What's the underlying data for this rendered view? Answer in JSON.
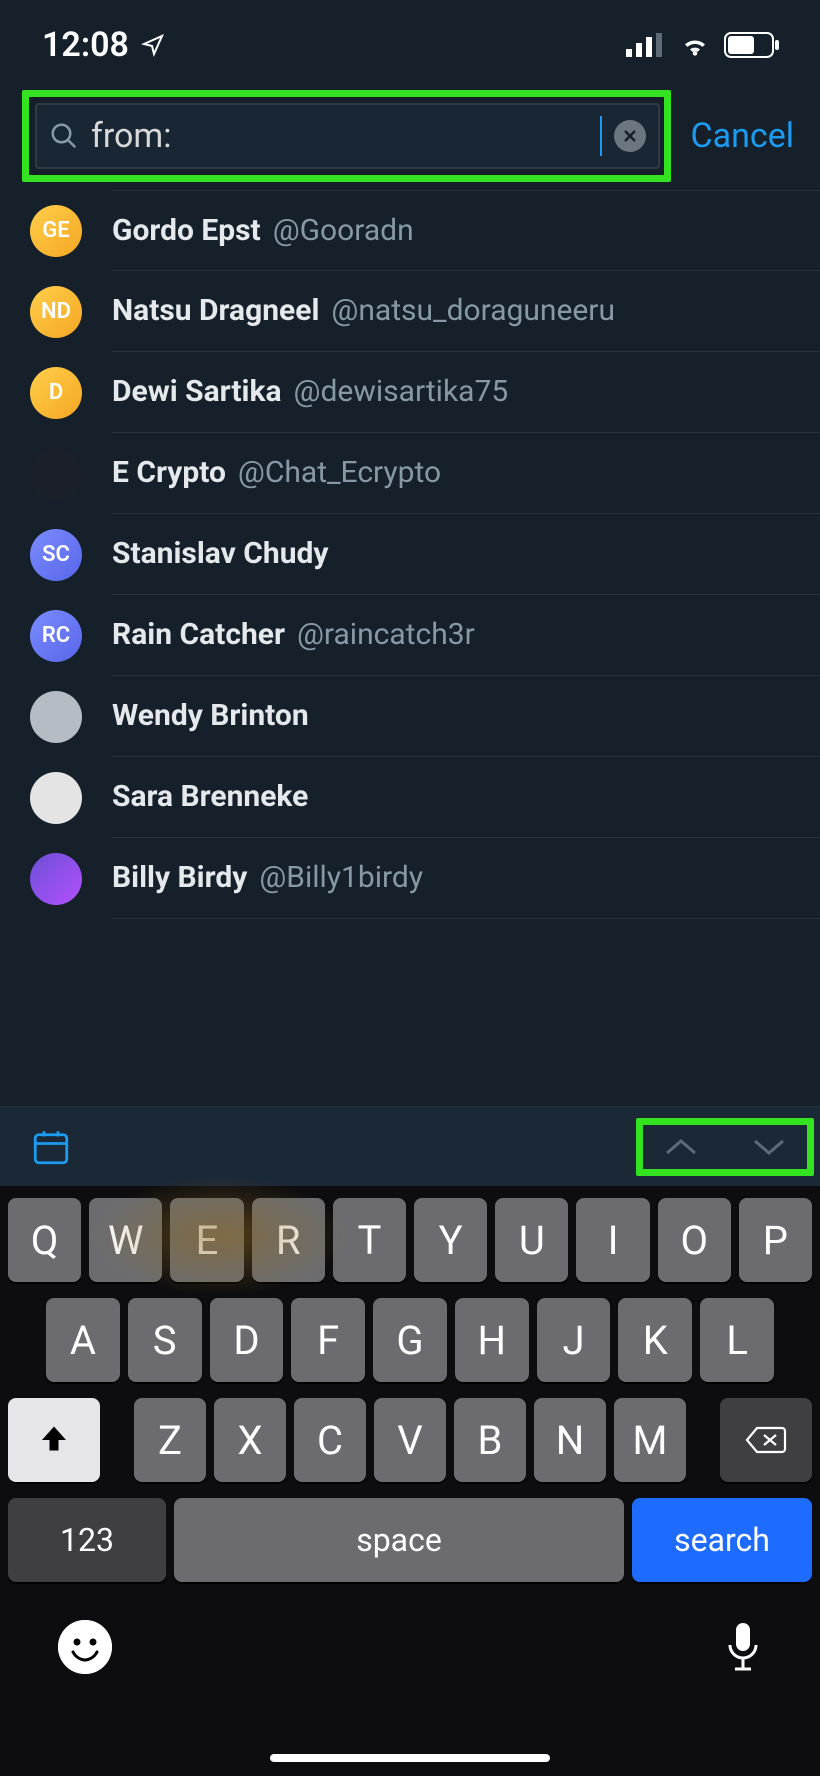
{
  "status": {
    "time": "12:08"
  },
  "search": {
    "value": "from: ",
    "cancel": "Cancel"
  },
  "suggestions": [
    {
      "initials": "GE",
      "name": "Gordo Epst",
      "handle": "@Gooradn",
      "avatar": "orange"
    },
    {
      "initials": "ND",
      "name": "Natsu Dragneel",
      "handle": "@natsu_doraguneeru",
      "avatar": "orange"
    },
    {
      "initials": "D",
      "name": "Dewi Sartika",
      "handle": "@dewisartika75",
      "avatar": "orange"
    },
    {
      "initials": "",
      "name": "E Crypto",
      "handle": "@Chat_Ecrypto",
      "avatar": "dark"
    },
    {
      "initials": "SC",
      "name": "Stanislav Chudy",
      "handle": "",
      "avatar": "blue1"
    },
    {
      "initials": "RC",
      "name": "Rain Catcher",
      "handle": "@raincatch3r",
      "avatar": "blue2"
    },
    {
      "initials": "",
      "name": "Wendy Brinton",
      "handle": "",
      "avatar": "grey"
    },
    {
      "initials": "",
      "name": "Sara Brenneke",
      "handle": "",
      "avatar": "white"
    },
    {
      "initials": "",
      "name": "Billy Birdy",
      "handle": "@Billy1birdy",
      "avatar": "purple"
    }
  ],
  "keyboard": {
    "row1": [
      "Q",
      "W",
      "E",
      "R",
      "T",
      "Y",
      "U",
      "I",
      "O",
      "P"
    ],
    "row2": [
      "A",
      "S",
      "D",
      "F",
      "G",
      "H",
      "J",
      "K",
      "L"
    ],
    "row3": [
      "Z",
      "X",
      "C",
      "V",
      "B",
      "N",
      "M"
    ],
    "num_label": "123",
    "space_label": "space",
    "search_label": "search"
  }
}
